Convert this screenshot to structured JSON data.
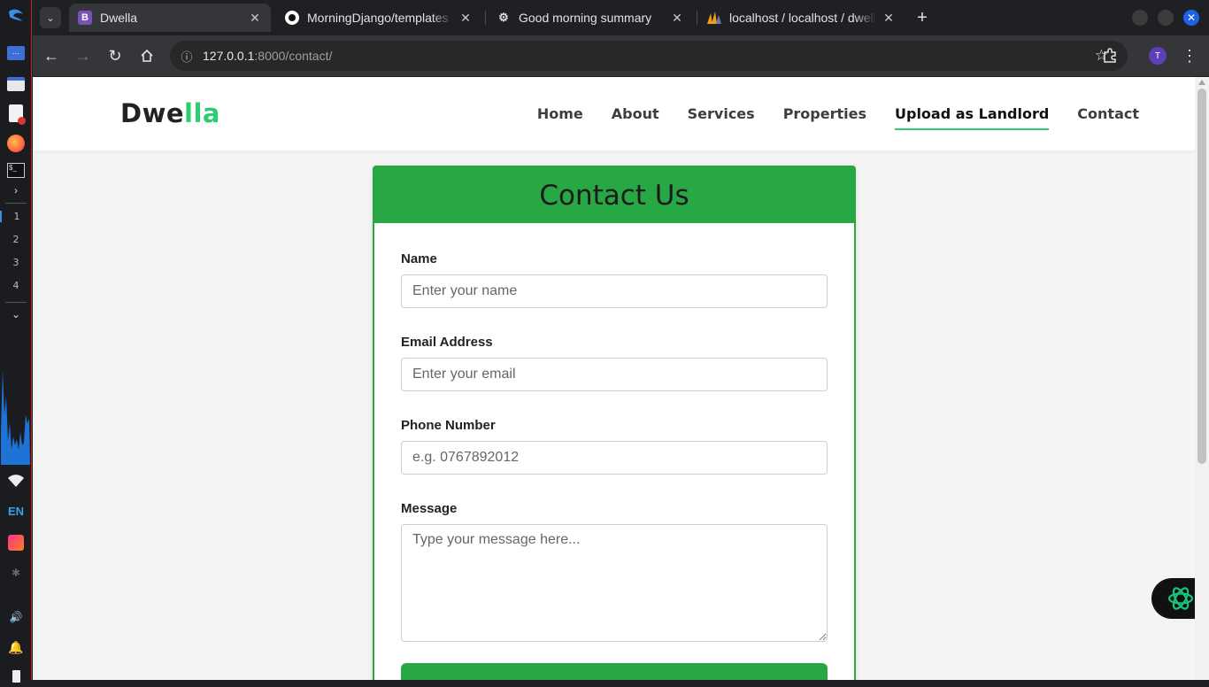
{
  "browser": {
    "tabs": [
      {
        "title": "Dwella",
        "icon": "bootstrap-icon",
        "icon_text": "B",
        "active": true
      },
      {
        "title": "MorningDjango/templates",
        "icon": "github-icon",
        "active": false
      },
      {
        "title": "Good morning summary",
        "icon": "openai-icon",
        "active": false
      },
      {
        "title": "localhost / localhost / dwella",
        "icon": "phpmyadmin-icon",
        "active": false
      }
    ],
    "url_host": "127.0.0.1",
    "url_rest": ":8000/contact/",
    "profile_initial": "T"
  },
  "dock": {
    "workspaces": [
      "1",
      "2",
      "3",
      "4"
    ],
    "language": "EN"
  },
  "site": {
    "logo_main": "Dwe",
    "logo_accent": "lla",
    "nav": [
      {
        "label": "Home",
        "active": false
      },
      {
        "label": "About",
        "active": false
      },
      {
        "label": "Services",
        "active": false
      },
      {
        "label": "Properties",
        "active": false
      },
      {
        "label": "Upload as Landlord",
        "active": true
      },
      {
        "label": "Contact",
        "active": false
      }
    ]
  },
  "contact_form": {
    "title": "Contact Us",
    "name_label": "Name",
    "name_placeholder": "Enter your name",
    "email_label": "Email Address",
    "email_placeholder": "Enter your email",
    "phone_label": "Phone Number",
    "phone_placeholder": "e.g. 0767892012",
    "message_label": "Message",
    "message_placeholder": "Type your message here..."
  },
  "colors": {
    "brand_green": "#28a745",
    "logo_green": "#2ecc71",
    "browser_dark": "#1f2023"
  }
}
